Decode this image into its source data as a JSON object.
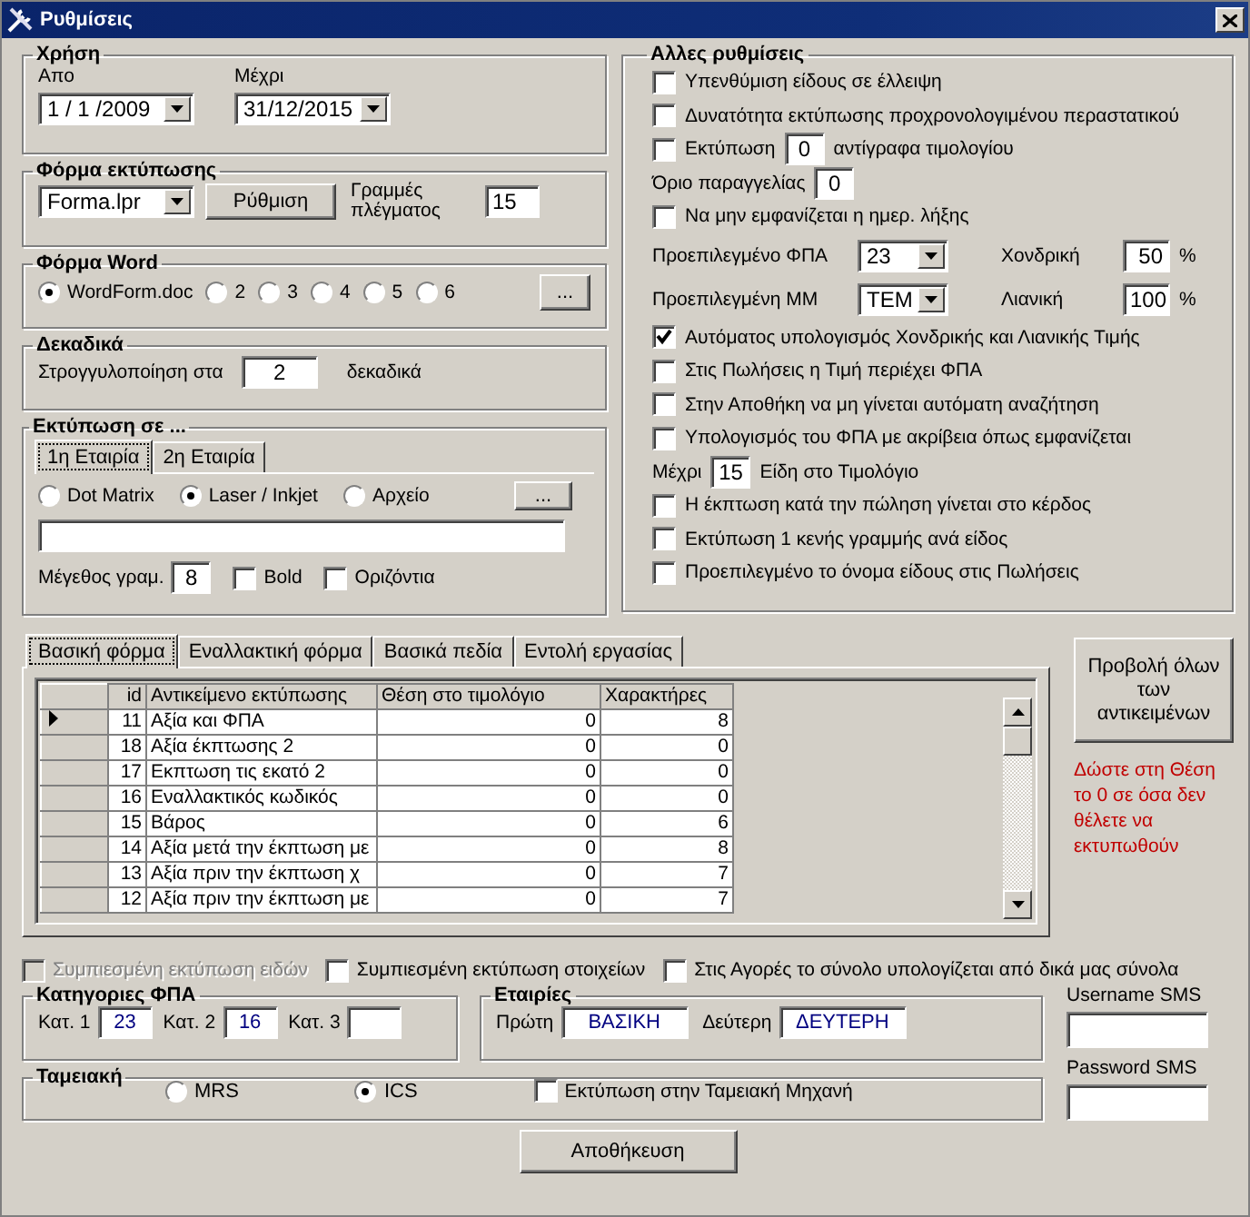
{
  "window": {
    "title": "Ρυθμίσεις"
  },
  "usage": {
    "title": "Χρήση",
    "from_label": "Απο",
    "from": "1 / 1 /2009",
    "to_label": "Μέχρι",
    "to": "31/12/2015"
  },
  "print_form": {
    "title": "Φόρμα εκτύπωσης",
    "form": "Forma.lpr",
    "setup_button": "Ρύθμιση",
    "grid_lines_label": "Γραμμές πλέγματος",
    "grid_lines": "15"
  },
  "word_form": {
    "title": "Φόρμα Word",
    "options": [
      {
        "label": "WordForm.doc",
        "selected": true
      },
      {
        "label": "2",
        "selected": false
      },
      {
        "label": "3",
        "selected": false
      },
      {
        "label": "4",
        "selected": false
      },
      {
        "label": "5",
        "selected": false
      },
      {
        "label": "6",
        "selected": false
      }
    ],
    "browse_button": "..."
  },
  "decimals": {
    "title": "Δεκαδικά",
    "label": "Στρογγυλοποίηση στα",
    "value": "2",
    "unit": "δεκαδικά"
  },
  "print_to": {
    "title": "Εκτύπωση σε ...",
    "tabs": [
      {
        "label": "1η Εταιρία",
        "selected": true
      },
      {
        "label": "2η Εταιρία",
        "selected": false
      }
    ],
    "printers": [
      {
        "label": "Dot Matrix",
        "selected": false
      },
      {
        "label": "Laser / Inkjet",
        "selected": true
      },
      {
        "label": "Αρχείο",
        "selected": false
      }
    ],
    "browse_button": "...",
    "font_size_label": "Μέγεθος γραμ.",
    "font_size": "8",
    "options": [
      {
        "label": "Bold",
        "checked": false
      },
      {
        "label": "Οριζόντια",
        "checked": false
      }
    ]
  },
  "other": {
    "title": "Αλλες ρυθμίσεις",
    "rows": [
      {
        "kind": "check",
        "label": "Υπενθύμιση είδους σε έλλειψη",
        "checked": false
      },
      {
        "kind": "check",
        "label": "Δυνατότητα εκτύπωσης προχρονολογιμένου περαστατικού",
        "checked": false
      },
      {
        "kind": "check_field",
        "label": "Εκτύπωση",
        "value": "0",
        "suffix": "αντίγραφα τιμολογίου",
        "checked": false
      },
      {
        "kind": "field",
        "label": "Όριο παραγγελίας",
        "value": "0"
      },
      {
        "kind": "check",
        "label": "Να μην εμφανίζεται η ημερ. λήξης",
        "checked": false
      },
      {
        "kind": "select_pct",
        "label": "Προεπιλεγμένο ΦΠΑ",
        "select": "23",
        "label2": "Χονδρική",
        "value": "50",
        "unit": "%"
      },
      {
        "kind": "select_pct",
        "label": "Προεπιλεγμένη ΜΜ",
        "select": "ΤΕΜ",
        "label2": "Λιανική",
        "value": "100",
        "unit": "%"
      },
      {
        "kind": "check",
        "label": "Αυτόματος υπολογισμός Χονδρικής και Λιανικής Τιμής",
        "checked": true
      },
      {
        "kind": "check",
        "label": "Στις Πωλήσεις η Τιμή περιέχει ΦΠΑ",
        "checked": false
      },
      {
        "kind": "check",
        "label": "Στην Αποθήκη να μη γίνεται αυτόματη αναζήτηση",
        "checked": false
      },
      {
        "kind": "check",
        "label": "Υπολογισμός του ΦΠΑ με ακρίβεια όπως εμφανίζεται",
        "checked": false
      },
      {
        "kind": "field",
        "label": "Μέχρι",
        "value": "15",
        "suffix": "Είδη στο Τιμολόγιο"
      },
      {
        "kind": "check",
        "label": "Η έκπτωση κατά την πώληση γίνεται στο κέρδος",
        "checked": false
      },
      {
        "kind": "check",
        "label": "Εκτύπωση 1 κενής γραμμής ανά είδος",
        "checked": false
      },
      {
        "kind": "check",
        "label": "Προεπιλεγμένο το όνομα είδους στις Πωλήσεις",
        "checked": false
      }
    ]
  },
  "layout_tabs": [
    {
      "label": "Βασική φόρμα",
      "selected": true
    },
    {
      "label": "Εναλλακτική φόρμα",
      "selected": false
    },
    {
      "label": "Βασικά πεδία",
      "selected": false
    },
    {
      "label": "Εντολή εργασίας",
      "selected": false
    }
  ],
  "table": {
    "columns": [
      "id",
      "Αντικείμενο εκτύπωσης",
      "Θέση στο τιμολόγιο",
      "Χαρακτήρες"
    ],
    "rows": [
      {
        "cells": [
          "11",
          "Αξία και ΦΠΑ",
          "0",
          "8"
        ],
        "selected": true
      },
      {
        "cells": [
          "18",
          "Αξία έκπτωσης 2",
          "0",
          "0"
        ],
        "selected": false
      },
      {
        "cells": [
          "17",
          "Εκπτωση τις εκατό 2",
          "0",
          "0"
        ],
        "selected": false
      },
      {
        "cells": [
          "16",
          "Εναλλακτικός κωδικός",
          "0",
          "0"
        ],
        "selected": false
      },
      {
        "cells": [
          "15",
          "Βάρος",
          "0",
          "6"
        ],
        "selected": false
      },
      {
        "cells": [
          "14",
          "Αξία μετά την έκπτωση με",
          "0",
          "8"
        ],
        "selected": false
      },
      {
        "cells": [
          "13",
          "Αξία πριν την έκπτωση χ",
          "0",
          "7"
        ],
        "selected": false
      },
      {
        "cells": [
          "12",
          "Αξία πριν την έκπτωση με",
          "0",
          "7"
        ],
        "selected": false
      }
    ]
  },
  "show_all_button": "Προβολή όλων των αντικειμένων",
  "note": "Δώστε στη Θέση το 0 σε όσα δεν θέλετε να εκτυπωθούν",
  "bottom_checks": [
    {
      "label": "Συμπιεσμένη εκτύπωση ειδών",
      "checked": false,
      "disabled": true
    },
    {
      "label": "Συμπιεσμένη εκτύπωση στοιχείων",
      "checked": false,
      "disabled": false
    },
    {
      "label": "Στις Αγορές το σύνολο υπολογίζεται  από δικά μας σύνολα",
      "checked": false,
      "disabled": false
    }
  ],
  "vat": {
    "title": "Κατηγοριες ΦΠΑ",
    "fields": [
      {
        "label": "Κατ. 1",
        "value": "23"
      },
      {
        "label": "Κατ. 2",
        "value": "16"
      },
      {
        "label": "Κατ. 3"
      }
    ]
  },
  "companies": {
    "title": "Εταιρίες",
    "fields": [
      {
        "label": "Πρώτη",
        "value": "ΒΑΣΙΚΗ"
      },
      {
        "label": "Δεύτερη",
        "value": "ΔΕΥΤΕΡΗ"
      }
    ]
  },
  "sms": {
    "username_label": "Username SMS",
    "password_label": "Password SMS"
  },
  "cash_register": {
    "title": "Ταμειακή",
    "options": [
      {
        "label": "MRS",
        "selected": false
      },
      {
        "label": "ICS",
        "selected": true
      }
    ],
    "print_check": {
      "label": "Εκτύπωση στην Ταμειακή Μηχανή",
      "checked": false
    }
  },
  "save_button": "Αποθήκευση"
}
